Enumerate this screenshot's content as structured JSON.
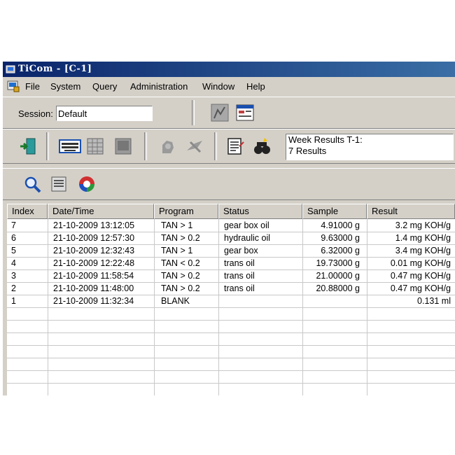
{
  "window": {
    "title": "TiCom - [C-1]"
  },
  "menu": [
    "File",
    "System",
    "Query",
    "Administration",
    "Window",
    "Help"
  ],
  "session": {
    "label": "Session:",
    "value": "Default"
  },
  "status": {
    "line1": "Week Results T-1:",
    "line2": "7 Results"
  },
  "table": {
    "columns": [
      "Index",
      "Date/Time",
      "Program",
      "Status",
      "Sample",
      "Result"
    ],
    "rows": [
      [
        "7",
        "21-10-2009  13:12:05",
        "TAN > 1",
        "gear box oil",
        "4.91000 g",
        "3.2 mg KOH/g"
      ],
      [
        "6",
        "21-10-2009  12:57:30",
        "TAN > 0.2",
        "hydraulic oil",
        "9.63000 g",
        "1.4 mg KOH/g"
      ],
      [
        "5",
        "21-10-2009  12:32:43",
        "TAN > 1",
        "gear box",
        "6.32000 g",
        "3.4 mg KOH/g"
      ],
      [
        "4",
        "21-10-2009  12:22:48",
        "TAN < 0.2",
        "trans oil",
        "19.73000 g",
        "0.01 mg KOH/g"
      ],
      [
        "3",
        "21-10-2009  11:58:54",
        "TAN > 0.2",
        "trans oil",
        "21.00000 g",
        "0.47 mg KOH/g"
      ],
      [
        "2",
        "21-10-2009  11:48:00",
        "TAN > 0.2",
        "trans oil",
        "20.88000 g",
        "0.47 mg KOH/g"
      ],
      [
        "1",
        "21-10-2009  11:32:34",
        "BLANK",
        "",
        "",
        "0.131 ml"
      ]
    ]
  },
  "colors": {
    "titlebar": "#0a246a",
    "chrome": "#d4d0c8"
  }
}
